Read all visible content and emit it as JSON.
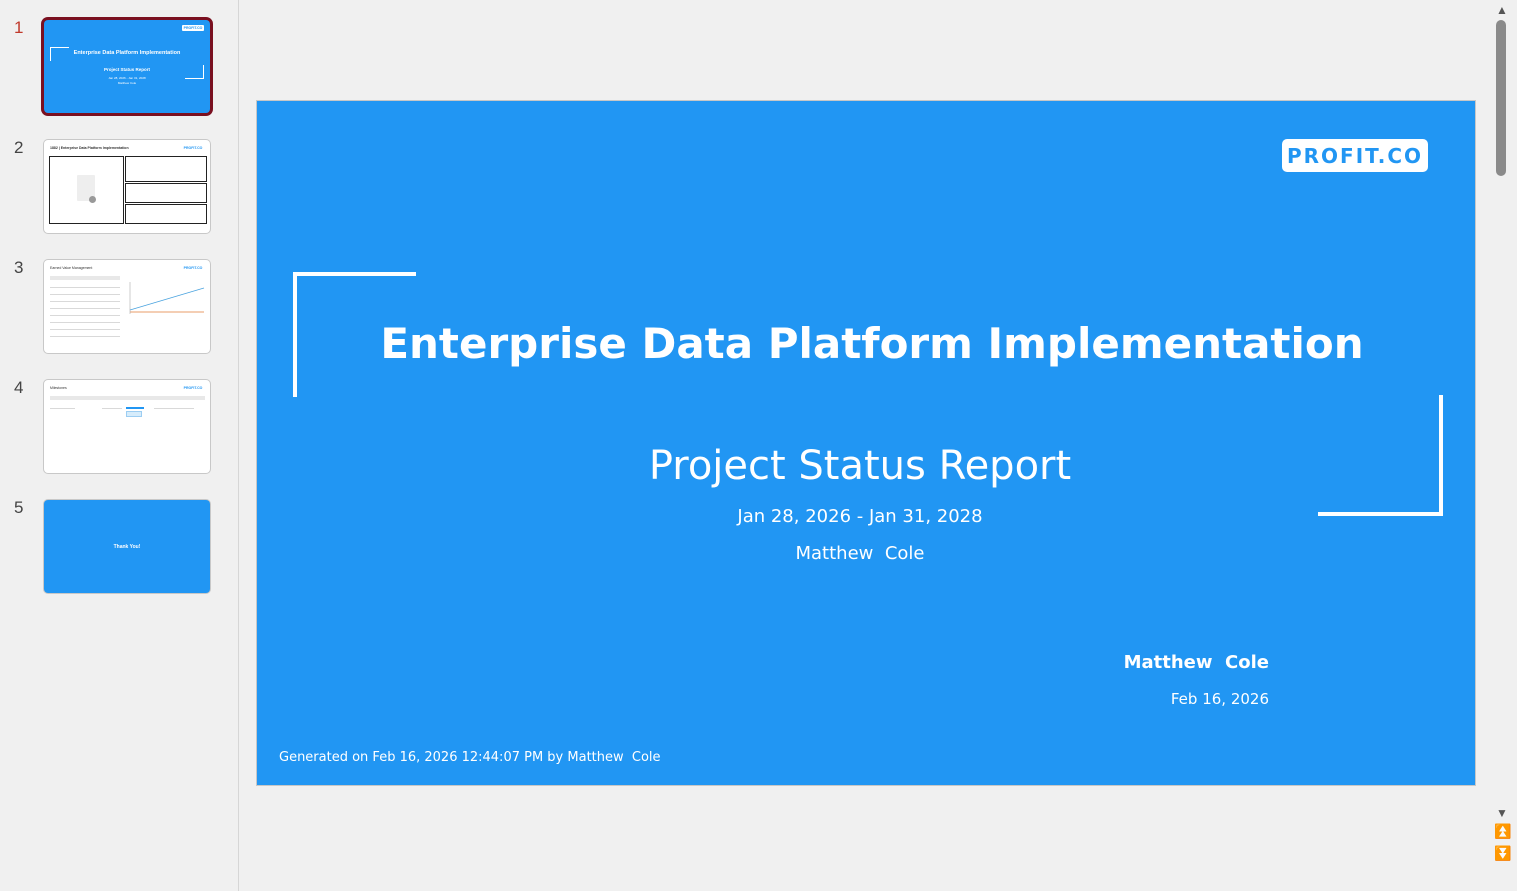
{
  "thumbnails": [
    {
      "number": "1",
      "title": "Enterprise Data Platform Implementation",
      "subtitle": "Project Status Report",
      "dates": "Jan 28, 2026 - Jan 31, 2028",
      "owner": "Matthew  Cole"
    },
    {
      "number": "2",
      "title": "1882 | Enterprise Data Platform Implementation"
    },
    {
      "number": "3",
      "title": "Earned Value Management"
    },
    {
      "number": "4",
      "title": "Milestones"
    },
    {
      "number": "5",
      "title": "Thank You!"
    }
  ],
  "slide": {
    "logo": "PROFIT.CO",
    "title": "Enterprise Data Platform Implementation",
    "subtitle": "Project Status Report",
    "dates": "Jan 28, 2026 - Jan 31, 2028",
    "owner": "Matthew  Cole",
    "presenter": "Matthew  Cole",
    "date": "Feb 16, 2026",
    "generated": "Generated on Feb 16, 2026 12:44:07 PM by Matthew  Cole"
  },
  "colors": {
    "slide_bg": "#2196f3",
    "active_border": "#7a1020",
    "active_number": "#c0392b"
  },
  "icons": {
    "scroll_up": "triangle-up-icon",
    "scroll_down": "triangle-down-icon",
    "prev_slide": "double-triangle-up-icon",
    "next_slide": "double-triangle-down-icon"
  }
}
